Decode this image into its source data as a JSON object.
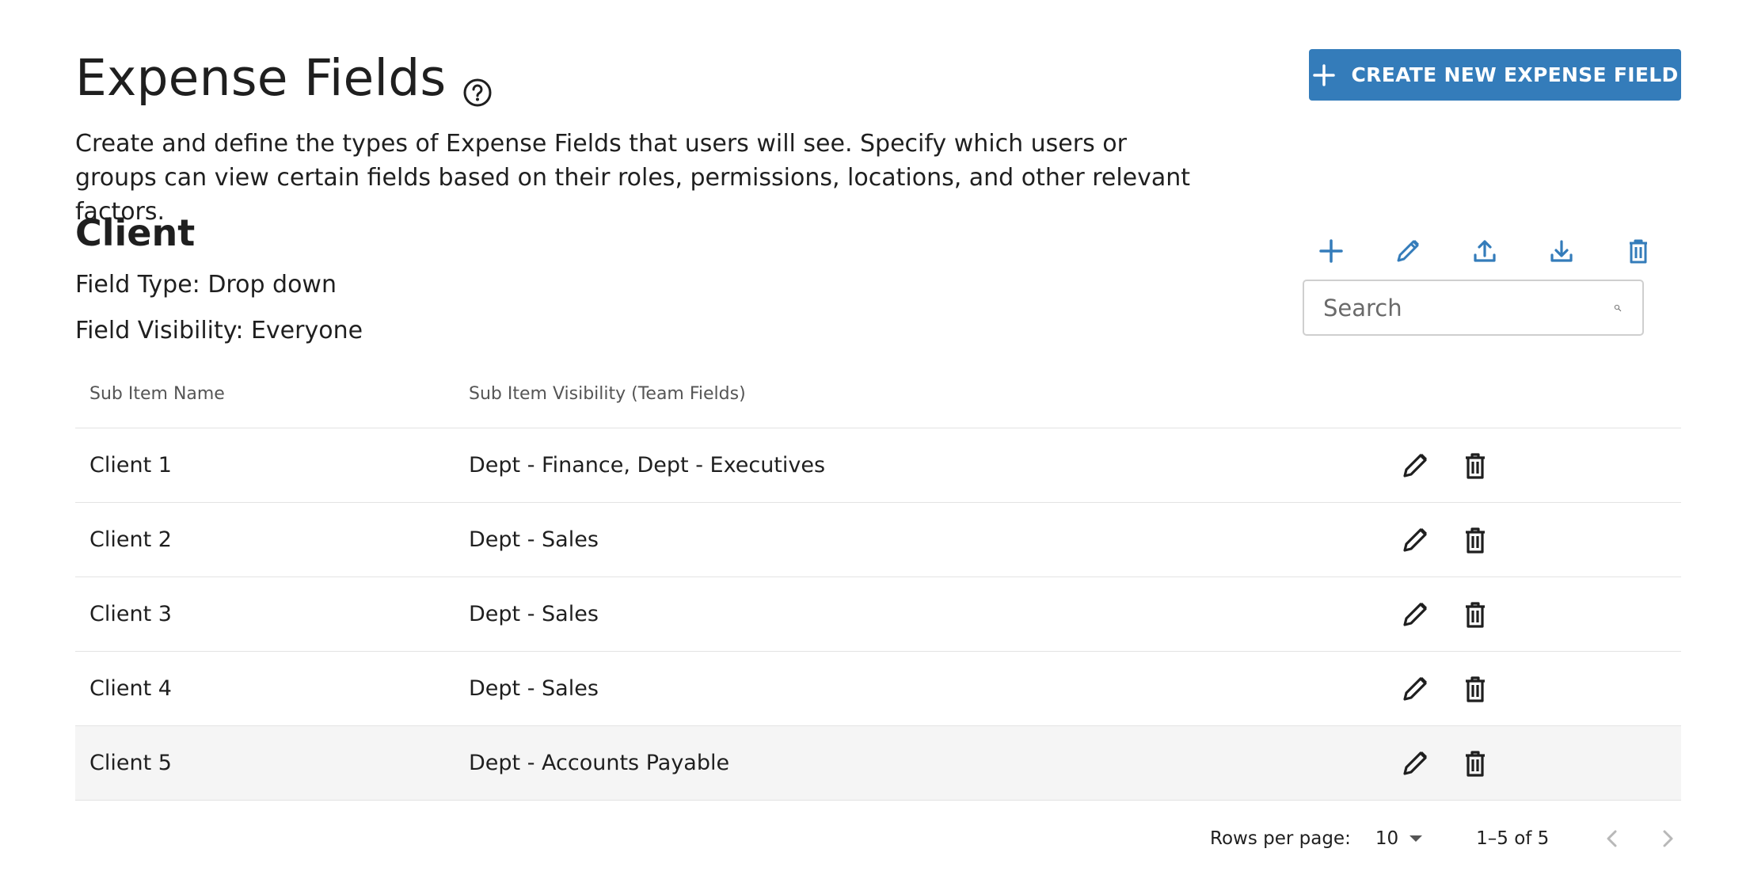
{
  "header": {
    "title": "Expense Fields",
    "create_button_label": "CREATE NEW EXPENSE FIELD"
  },
  "description": "Create and define the types of Expense Fields that users will see. Specify which users or groups can view certain fields based on their roles, permissions, locations, and other relevant factors.",
  "section": {
    "title": "Client",
    "field_type": "Field Type: Drop down",
    "field_visibility": "Field Visibility: Everyone"
  },
  "toolbar": {
    "icons": [
      "plus-icon",
      "pencil-icon",
      "upload-icon",
      "download-icon",
      "trash-icon"
    ]
  },
  "search": {
    "placeholder": "Search",
    "value": ""
  },
  "table": {
    "columns": [
      "Sub Item Name",
      "Sub Item Visibility (Team Fields)"
    ],
    "rows": [
      {
        "name": "Client 1",
        "visibility": "Dept - Finance, Dept - Executives"
      },
      {
        "name": "Client 2",
        "visibility": "Dept - Sales"
      },
      {
        "name": "Client 3",
        "visibility": "Dept - Sales"
      },
      {
        "name": "Client 4",
        "visibility": "Dept - Sales"
      },
      {
        "name": "Client 5",
        "visibility": "Dept - Accounts Payable"
      }
    ]
  },
  "pagination": {
    "rows_per_page_label": "Rows per page:",
    "rows_per_page": "10",
    "range": "1–5 of 5"
  },
  "colors": {
    "accent": "#347cba",
    "row_hover": "#f5f5f5",
    "text": "#1f1f1f"
  }
}
